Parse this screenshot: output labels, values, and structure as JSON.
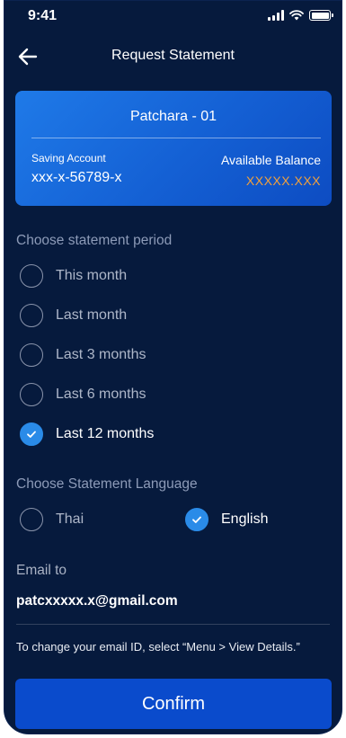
{
  "status_bar": {
    "time": "9:41",
    "icons": [
      "signal-icon",
      "wifi-icon",
      "battery-icon"
    ]
  },
  "header": {
    "title": "Request Statement",
    "back_icon": "arrow-left-icon"
  },
  "account_card": {
    "name": "Patchara - 01",
    "account_type": "Saving Account",
    "account_number": "xxx-x-56789-x",
    "balance_label": "Available Balance",
    "balance_value": "XXXXX.XXX"
  },
  "statement_period": {
    "label": "Choose statement period",
    "options": [
      {
        "label": "This month",
        "selected": false
      },
      {
        "label": "Last month",
        "selected": false
      },
      {
        "label": "Last 3 months",
        "selected": false
      },
      {
        "label": "Last 6 months",
        "selected": false
      },
      {
        "label": "Last 12 months",
        "selected": true
      }
    ]
  },
  "statement_language": {
    "label": "Choose Statement Language",
    "options": [
      {
        "label": "Thai",
        "selected": false
      },
      {
        "label": "English",
        "selected": true
      }
    ]
  },
  "email": {
    "label": "Email to",
    "value": "patcxxxxx.x@gmail.com",
    "note": "To change your email ID, select “Menu > View Details.”"
  },
  "confirm_label": "Confirm",
  "colors": {
    "background": "#061a3d",
    "card_gradient_start": "#1f7ae8",
    "card_gradient_end": "#0d4cc2",
    "balance": "#f3a13b",
    "radio_selected": "#2a8be8",
    "button": "#0a4bcc"
  }
}
